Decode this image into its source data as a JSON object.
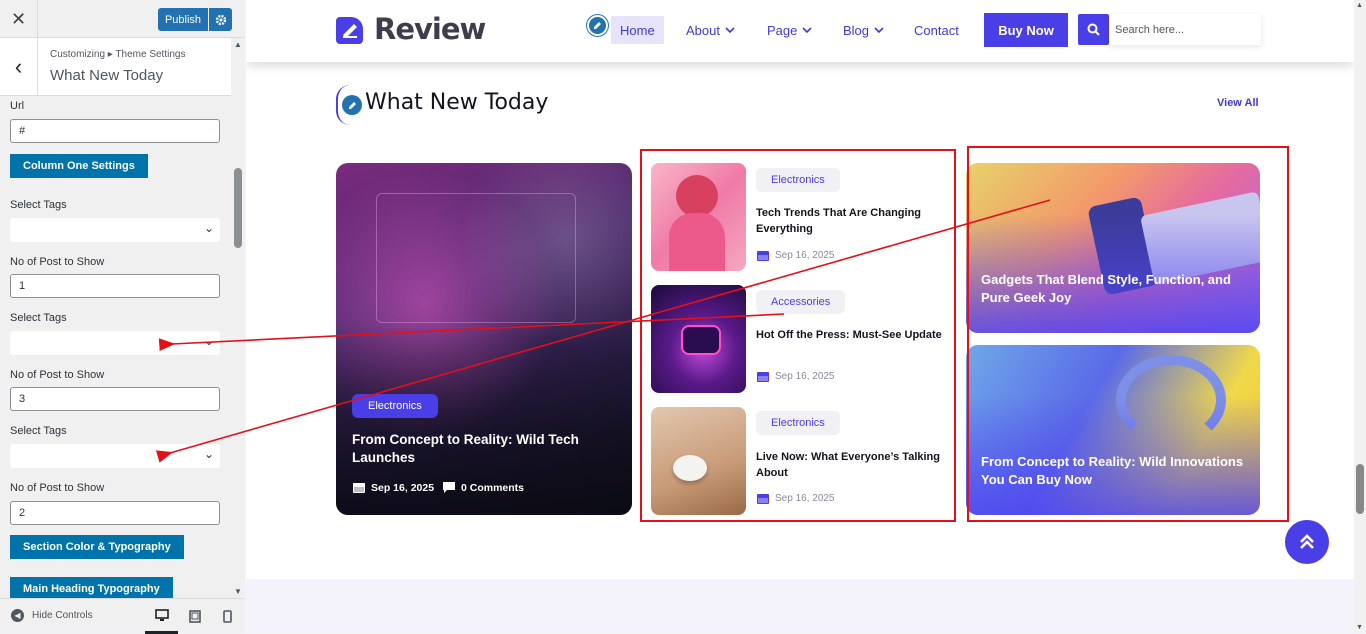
{
  "customizer": {
    "close_glyph": "✕",
    "publish_label": "Publish",
    "back_glyph": "‹",
    "breadcrumb": "Customizing ▸ Theme Settings",
    "section_title": "What New Today",
    "fields": {
      "url_label": "Url",
      "url_value": "#",
      "col1_button": "Column One Settings",
      "tags1_label": "Select Tags",
      "posts1_label": "No of Post to Show",
      "posts1_value": "1",
      "tags2_label": "Select Tags",
      "posts2_label": "No of Post to Show",
      "posts2_value": "3",
      "tags3_label": "Select Tags",
      "posts3_label": "No of Post to Show",
      "posts3_value": "2",
      "color_button": "Section Color & Typography",
      "heading_button": "Main Heading Typography"
    },
    "hide_controls": "Hide Controls"
  },
  "site": {
    "logo_text": "Review",
    "nav": [
      "Home",
      "About",
      "Page",
      "Blog",
      "Contact"
    ],
    "buy_now": "Buy Now",
    "search_placeholder": "Search here...",
    "section_title": "What New Today",
    "view_all": "View All",
    "featured": {
      "tag": "Electronics",
      "title": "From Concept to Reality: Wild Tech Launches",
      "date": "Sep 16, 2025",
      "comments": "0 Comments"
    },
    "list": [
      {
        "tag": "Electronics",
        "title": "Tech Trends That Are Changing Everything",
        "date": "Sep 16, 2025"
      },
      {
        "tag": "Accessories",
        "title": "Hot Off the Press: Must-See Update",
        "date": "Sep 16, 2025"
      },
      {
        "tag": "Electronics",
        "title": "Live Now: What Everyone’s Talking About",
        "date": "Sep 16, 2025"
      }
    ],
    "cards": [
      {
        "title": "Gadgets That Blend Style, Function, and Pure Geek Joy"
      },
      {
        "title": "From Concept to Reality: Wild Innovations You Can Buy Now"
      }
    ]
  },
  "colors": {
    "accent": "#4a3ee6",
    "wp_blue": "#0073aa",
    "annotation_red": "#e3101a"
  },
  "icons": [
    "close-icon",
    "gear-icon",
    "back-arrow-icon",
    "chevron-down-icon",
    "calendar-icon",
    "comment-icon",
    "search-icon",
    "pencil-icon",
    "double-chevron-up-icon",
    "desktop-icon",
    "tablet-icon",
    "mobile-icon"
  ]
}
